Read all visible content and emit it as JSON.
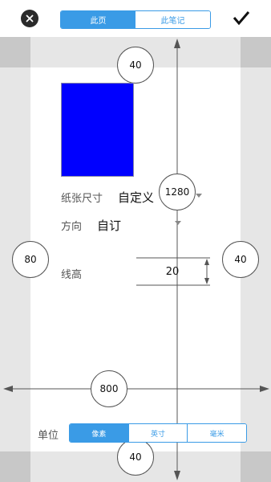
{
  "top_tabs": {
    "this_page": "此页",
    "this_note": "此笔记"
  },
  "margins": {
    "top": "40",
    "left": "80",
    "right": "40",
    "bottom": "40"
  },
  "paper": {
    "label": "纸张尺寸",
    "value": "自定义",
    "height_value": "1280",
    "width_value": "800"
  },
  "orientation": {
    "label": "方向",
    "value": "自订"
  },
  "line_height": {
    "label": "线高",
    "value": "20"
  },
  "unit": {
    "label": "单位",
    "options": [
      "像素",
      "英寸",
      "毫米"
    ],
    "selected": "像素"
  },
  "colors": {
    "accent": "#3a9be6",
    "preview": "#0000ff"
  },
  "icons": {
    "close": "close-icon",
    "confirm": "check-icon"
  }
}
